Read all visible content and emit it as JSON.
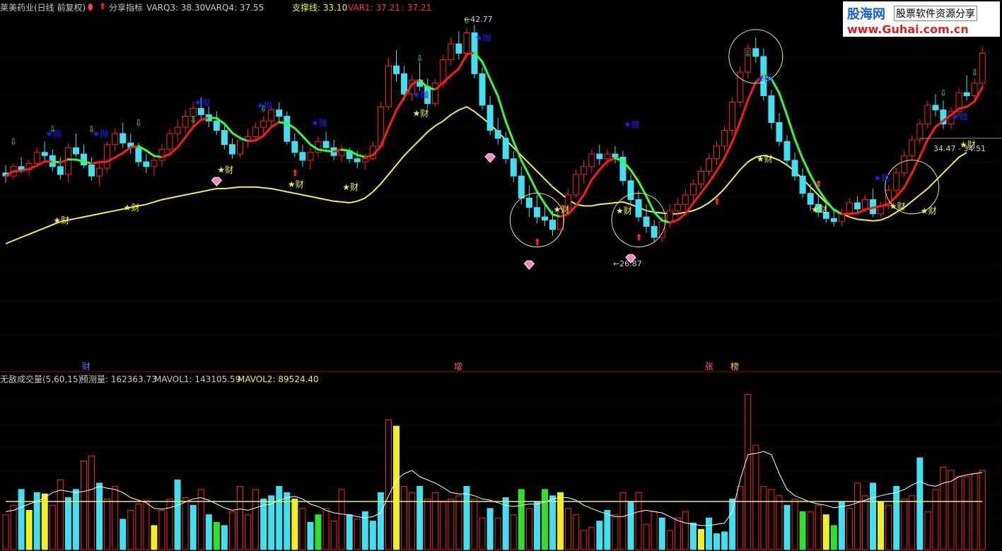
{
  "header": {
    "stock": "莱美药业(日线 前复权)",
    "indicator": "分享指标",
    "varq3": "VARQ3: 38.30",
    "varq4": "VARQ4: 37.55",
    "support": "支撑线: 33.10",
    "var1": "VAR1: 37.21",
    "var1b": ": 37.21"
  },
  "logo": {
    "brand": "股海网",
    "slogan": "股票软件资源分享",
    "url": "www.Guhai.com.cn"
  },
  "volume_header": {
    "title": "无敌成交量(5,60,15)",
    "forecast": "预测量: 162363.73",
    "mavol1": "MAVOL1: 143105.59",
    "mavol2": "MAVOL2: 89524.40"
  },
  "annotations": {
    "high_label": "42.77",
    "low_label": "26.87",
    "range_label": "34.47 - 34.51",
    "buy_text": "财",
    "sell_text": "抛",
    "bottom_labels": [
      "财",
      "增",
      "张",
      "榜"
    ]
  },
  "colors": {
    "up": "#ff2020",
    "down": "#40e0f0",
    "ma_red": "#ff1a1a",
    "ma_green": "#30ff30",
    "support": "#f0f040",
    "buy_star": "#f0f040",
    "sell_star": "#2020ff",
    "vol_yellow": "#f0f020",
    "vol_green": "#30e030"
  },
  "chart_data": {
    "type": "candlestick",
    "ylim": [
      24,
      46
    ],
    "candles": [
      [
        36.0,
        36.5,
        35.4,
        35.8
      ],
      [
        35.8,
        36.6,
        35.6,
        36.4
      ],
      [
        36.4,
        37.0,
        36.0,
        36.2
      ],
      [
        36.2,
        36.8,
        35.8,
        36.6
      ],
      [
        36.6,
        37.6,
        36.4,
        37.3
      ],
      [
        37.3,
        38.0,
        36.8,
        37.1
      ],
      [
        37.1,
        37.5,
        36.1,
        36.4
      ],
      [
        36.4,
        37.0,
        35.6,
        35.9
      ],
      [
        35.9,
        37.9,
        35.4,
        37.6
      ],
      [
        37.6,
        38.5,
        37.0,
        37.2
      ],
      [
        37.2,
        37.8,
        36.3,
        36.5
      ],
      [
        36.5,
        37.0,
        35.5,
        35.8
      ],
      [
        35.8,
        36.6,
        35.2,
        36.3
      ],
      [
        36.3,
        38.0,
        36.0,
        37.8
      ],
      [
        37.8,
        38.8,
        37.4,
        38.5
      ],
      [
        38.5,
        39.2,
        37.6,
        37.9
      ],
      [
        37.9,
        38.5,
        37.2,
        37.6
      ],
      [
        37.6,
        37.9,
        36.4,
        36.7
      ],
      [
        36.7,
        37.2,
        36.0,
        36.4
      ],
      [
        36.4,
        37.0,
        35.8,
        36.8
      ],
      [
        36.8,
        37.8,
        36.4,
        37.5
      ],
      [
        37.5,
        38.8,
        37.2,
        38.5
      ],
      [
        38.5,
        39.4,
        38.0,
        38.9
      ],
      [
        38.9,
        40.0,
        38.5,
        39.6
      ],
      [
        39.6,
        40.5,
        39.0,
        40.1
      ],
      [
        40.1,
        40.8,
        39.4,
        39.7
      ],
      [
        39.7,
        40.2,
        38.9,
        39.3
      ],
      [
        39.3,
        39.9,
        38.4,
        38.7
      ],
      [
        38.7,
        39.0,
        37.5,
        37.8
      ],
      [
        37.8,
        38.2,
        36.9,
        37.2
      ],
      [
        37.2,
        38.4,
        37.0,
        38.1
      ],
      [
        38.1,
        38.8,
        37.6,
        38.3
      ],
      [
        38.3,
        39.2,
        38.0,
        38.9
      ],
      [
        38.9,
        39.6,
        38.4,
        39.3
      ],
      [
        39.3,
        40.3,
        39.0,
        40.0
      ],
      [
        40.0,
        40.5,
        39.2,
        39.6
      ],
      [
        39.6,
        39.9,
        37.8,
        38.0
      ],
      [
        38.0,
        38.5,
        37.0,
        37.3
      ],
      [
        37.3,
        37.8,
        36.4,
        36.8
      ],
      [
        36.8,
        37.6,
        36.2,
        37.3
      ],
      [
        37.3,
        38.3,
        37.0,
        38.0
      ],
      [
        38.0,
        38.6,
        37.4,
        37.6
      ],
      [
        37.6,
        38.1,
        36.8,
        37.1
      ],
      [
        37.1,
        37.8,
        36.7,
        37.4
      ],
      [
        37.4,
        37.6,
        36.6,
        36.9
      ],
      [
        36.9,
        37.4,
        36.3,
        36.7
      ],
      [
        36.7,
        37.2,
        36.2,
        36.9
      ],
      [
        36.9,
        38.0,
        36.8,
        37.7
      ],
      [
        37.7,
        40.5,
        37.6,
        40.2
      ],
      [
        40.2,
        43.3,
        40.0,
        42.8
      ],
      [
        42.8,
        43.8,
        41.8,
        42.3
      ],
      [
        42.3,
        42.8,
        40.6,
        41.0
      ],
      [
        41.0,
        42.2,
        40.6,
        41.9
      ],
      [
        41.9,
        43.0,
        41.2,
        41.5
      ],
      [
        41.5,
        42.0,
        40.1,
        40.4
      ],
      [
        40.4,
        42.0,
        40.2,
        41.7
      ],
      [
        41.7,
        43.5,
        41.4,
        43.2
      ],
      [
        43.2,
        44.6,
        42.8,
        44.2
      ],
      [
        44.2,
        45.0,
        43.2,
        43.6
      ],
      [
        43.6,
        45.2,
        43.2,
        44.9
      ],
      [
        44.9,
        45.4,
        42.0,
        42.3
      ],
      [
        42.3,
        42.7,
        40.0,
        40.3
      ],
      [
        40.3,
        40.9,
        38.4,
        38.7
      ],
      [
        38.7,
        39.5,
        37.8,
        38.2
      ],
      [
        38.2,
        38.6,
        36.6,
        36.9
      ],
      [
        36.9,
        37.4,
        35.4,
        35.8
      ],
      [
        35.8,
        36.4,
        34.0,
        34.4
      ],
      [
        34.4,
        35.2,
        33.2,
        33.8
      ],
      [
        33.8,
        34.6,
        32.8,
        33.2
      ],
      [
        33.2,
        34.0,
        32.6,
        33.0
      ],
      [
        33.0,
        33.6,
        32.0,
        32.4
      ],
      [
        32.4,
        34.0,
        32.2,
        33.7
      ],
      [
        33.7,
        35.0,
        33.4,
        34.6
      ],
      [
        34.6,
        36.2,
        34.4,
        35.9
      ],
      [
        35.9,
        36.8,
        35.3,
        36.4
      ],
      [
        36.4,
        37.5,
        36.0,
        37.2
      ],
      [
        37.2,
        37.8,
        36.5,
        36.9
      ],
      [
        36.9,
        37.5,
        36.4,
        37.2
      ],
      [
        37.2,
        37.7,
        36.6,
        37.0
      ],
      [
        37.0,
        37.4,
        35.2,
        35.5
      ],
      [
        35.5,
        35.9,
        34.0,
        34.3
      ],
      [
        34.3,
        34.9,
        32.9,
        33.2
      ],
      [
        33.2,
        34.0,
        32.2,
        32.6
      ],
      [
        32.6,
        33.0,
        31.6,
        31.9
      ],
      [
        31.9,
        33.2,
        31.6,
        32.9
      ],
      [
        32.9,
        34.0,
        32.5,
        33.6
      ],
      [
        33.6,
        34.4,
        33.2,
        34.0
      ],
      [
        34.0,
        35.0,
        33.6,
        34.6
      ],
      [
        34.6,
        35.6,
        34.2,
        35.3
      ],
      [
        35.3,
        36.4,
        35.0,
        36.1
      ],
      [
        36.1,
        37.2,
        35.8,
        36.9
      ],
      [
        36.9,
        38.0,
        36.5,
        37.7
      ],
      [
        37.7,
        39.0,
        37.4,
        38.7
      ],
      [
        38.7,
        40.8,
        38.4,
        40.5
      ],
      [
        40.5,
        42.8,
        40.2,
        42.4
      ],
      [
        42.4,
        44.2,
        42.0,
        43.9
      ],
      [
        43.9,
        44.6,
        43.0,
        43.4
      ],
      [
        43.4,
        43.9,
        40.6,
        40.9
      ],
      [
        40.9,
        41.3,
        38.8,
        39.2
      ],
      [
        39.2,
        39.8,
        37.7,
        38.0
      ],
      [
        38.0,
        38.4,
        36.5,
        36.8
      ],
      [
        36.8,
        37.3,
        35.5,
        35.8
      ],
      [
        35.8,
        36.3,
        34.4,
        34.7
      ],
      [
        34.7,
        35.3,
        33.6,
        34.0
      ],
      [
        34.0,
        34.6,
        33.2,
        33.5
      ],
      [
        33.5,
        34.1,
        32.8,
        33.1
      ],
      [
        33.1,
        33.7,
        32.6,
        32.9
      ],
      [
        32.9,
        33.7,
        32.6,
        33.4
      ],
      [
        33.4,
        34.4,
        33.1,
        34.1
      ],
      [
        34.1,
        34.5,
        33.4,
        33.7
      ],
      [
        33.7,
        34.6,
        33.5,
        34.3
      ],
      [
        34.3,
        35.0,
        33.2,
        33.4
      ],
      [
        33.4,
        34.2,
        33.2,
        33.9
      ],
      [
        33.9,
        35.2,
        33.7,
        34.9
      ],
      [
        34.9,
        36.3,
        34.6,
        36.0
      ],
      [
        36.0,
        37.4,
        35.7,
        37.1
      ],
      [
        37.1,
        38.4,
        36.8,
        38.1
      ],
      [
        38.1,
        39.4,
        37.8,
        39.1
      ],
      [
        39.1,
        40.6,
        38.8,
        40.3
      ],
      [
        40.3,
        41.0,
        39.6,
        40.0
      ],
      [
        40.0,
        40.6,
        38.8,
        39.1
      ],
      [
        39.1,
        40.2,
        38.8,
        39.9
      ],
      [
        39.9,
        41.4,
        39.6,
        41.1
      ],
      [
        41.1,
        42.2,
        40.6,
        40.9
      ],
      [
        40.9,
        42.0,
        40.6,
        41.7
      ],
      [
        41.7,
        44.0,
        41.5,
        43.6
      ]
    ],
    "support": [
      31.5,
      31.7,
      31.9,
      32.1,
      32.3,
      32.5,
      32.7,
      32.9,
      33.0,
      33.1,
      33.2,
      33.3,
      33.4,
      33.5,
      33.6,
      33.7,
      33.8,
      33.9,
      34.0,
      34.15,
      34.3,
      34.4,
      34.5,
      34.6,
      34.7,
      34.8,
      34.9,
      35.0,
      35.0,
      35.05,
      35.1,
      35.1,
      35.1,
      35.05,
      35.0,
      34.9,
      34.8,
      34.7,
      34.6,
      34.5,
      34.4,
      34.3,
      34.2,
      34.15,
      34.1,
      34.2,
      34.4,
      34.8,
      35.3,
      35.9,
      36.5,
      37.1,
      37.6,
      38.1,
      38.6,
      39.0,
      39.3,
      39.7,
      40.0,
      40.2,
      39.9,
      39.5,
      39.1,
      38.6,
      38.1,
      37.6,
      37.1,
      36.6,
      36.1,
      35.6,
      35.1,
      34.7,
      34.3,
      34.0,
      33.9,
      33.9,
      34.0,
      34.05,
      34.1,
      34.15,
      34.0,
      33.8,
      33.6,
      33.5,
      33.45,
      33.4,
      33.4,
      33.5,
      33.6,
      33.8,
      34.1,
      34.5,
      35.0,
      35.6,
      36.2,
      36.7,
      37.0,
      37.1,
      37.0,
      36.8,
      36.5,
      36.1,
      35.6,
      35.1,
      34.6,
      34.1,
      33.7,
      33.4,
      33.2,
      33.05,
      33.0,
      32.95,
      33.0,
      33.2,
      33.5,
      33.8,
      34.2,
      34.6,
      35.0,
      35.5,
      36.0,
      36.5,
      37.0,
      37.3
    ],
    "buy_signals": [
      [
        7,
        32.8
      ],
      [
        16,
        33.6
      ],
      [
        28,
        36.0
      ],
      [
        37,
        35.1
      ],
      [
        44,
        34.9
      ],
      [
        53,
        39.6
      ],
      [
        71,
        33.5
      ],
      [
        79,
        33.4
      ],
      [
        97,
        36.7
      ],
      [
        104,
        33.5
      ],
      [
        114,
        33.7
      ],
      [
        118,
        33.4
      ],
      [
        123,
        37.6
      ]
    ],
    "sell_signals": [
      [
        6,
        38.3
      ],
      [
        12,
        38.3
      ],
      [
        25,
        40.3
      ],
      [
        33,
        40.1
      ],
      [
        40,
        39.0
      ],
      [
        53,
        40.8
      ],
      [
        61,
        44.4
      ],
      [
        80,
        38.9
      ],
      [
        97,
        41.8
      ],
      [
        112,
        35.5
      ],
      [
        122,
        39.4
      ]
    ],
    "up_arrows": [
      [
        37,
        35.8
      ],
      [
        68,
        31.4
      ],
      [
        81,
        31.7
      ],
      [
        91,
        34.0
      ],
      [
        104,
        35.1
      ]
    ],
    "down_arrows": [
      [
        1,
        37.8
      ],
      [
        6,
        38.6
      ],
      [
        11,
        38.6
      ],
      [
        17,
        39.0
      ],
      [
        24,
        39.2
      ],
      [
        33,
        39.9
      ],
      [
        53,
        43.1
      ],
      [
        59,
        45.5
      ],
      [
        95,
        43.4
      ],
      [
        120,
        40.9
      ],
      [
        124,
        42.2
      ]
    ],
    "diamonds": [
      [
        27,
        35.4
      ],
      [
        62,
        36.9
      ],
      [
        67,
        30.1
      ],
      [
        80,
        30.5
      ]
    ],
    "circles": [
      [
        68,
        33.0
      ],
      [
        81,
        33.0
      ],
      [
        96,
        43.4
      ],
      [
        116,
        35.1
      ]
    ],
    "volume_ylim": [
      0,
      260000
    ],
    "volume": [
      55000,
      70000,
      95000,
      62000,
      90000,
      88000,
      70000,
      110000,
      82000,
      95000,
      140000,
      148000,
      105000,
      80000,
      100000,
      48000,
      62000,
      72000,
      78000,
      38000,
      62000,
      80000,
      110000,
      82000,
      70000,
      95000,
      55000,
      43000,
      38000,
      60000,
      100000,
      55000,
      95000,
      80000,
      85000,
      100000,
      90000,
      80000,
      65000,
      43000,
      55000,
      65000,
      45000,
      95000,
      55000,
      48000,
      60000,
      45000,
      90000,
      205000,
      195000,
      100000,
      90000,
      100000,
      80000,
      90000,
      75000,
      80000,
      85000,
      100000,
      80000,
      50000,
      65000,
      50000,
      82000,
      55000,
      95000,
      65000,
      75000,
      95000,
      85000,
      90000,
      65000,
      55000,
      30000,
      35000,
      45000,
      62000,
      55000,
      90000,
      75000,
      90000,
      40000,
      60000,
      50000,
      30000,
      50000,
      60000,
      42000,
      32000,
      50000,
      25000,
      28000,
      80000,
      100000,
      245000,
      165000,
      100000,
      95000,
      85000,
      70000,
      80000,
      60000,
      60000,
      70000,
      55000,
      38000,
      75000,
      65000,
      105000,
      85000,
      105000,
      75000,
      70000,
      100000,
      80000,
      85000,
      145000,
      60000,
      95000,
      130000,
      125000,
      115000,
      115000,
      120000,
      125000
    ],
    "volume_colors": "RRcYcYRRccRRcRRcRRRYRRcRcRcGcRRRRccccYRcGRRRcRcccRYRRcRRRRRcRRcRcRGRcGcYRRRRccRRcRRRcRRRcYccccRRRRRRcRGRRYGcRRRcYRcRRcRRR",
    "mavol1": [
      60000,
      62000,
      67000,
      72000,
      76000,
      82000,
      90000,
      94000,
      92000,
      90000,
      92000,
      95000,
      100000,
      97000,
      95000,
      90000,
      82000,
      78000,
      74000,
      65000,
      64000,
      66000,
      70000,
      75000,
      80000,
      82000,
      78000,
      72000,
      66000,
      62000,
      64000,
      62000,
      66000,
      70000,
      72000,
      78000,
      82000,
      84000,
      80000,
      72000,
      68000,
      62000,
      58000,
      56000,
      55000,
      52000,
      50000,
      52000,
      58000,
      85000,
      110000,
      120000,
      125000,
      115000,
      110000,
      105000,
      98000,
      90000,
      88000,
      88000,
      85000,
      80000,
      78000,
      74000,
      70000,
      68000,
      70000,
      72000,
      72000,
      75000,
      80000,
      82000,
      82000,
      78000,
      70000,
      65000,
      60000,
      56000,
      52000,
      52000,
      56000,
      60000,
      62000,
      60000,
      58000,
      52000,
      46000,
      42000,
      40000,
      38000,
      38000,
      40000,
      42000,
      60000,
      110000,
      150000,
      152000,
      155000,
      150000,
      120000,
      95000,
      85000,
      80000,
      75000,
      72000,
      70000,
      66000,
      68000,
      70000,
      74000,
      78000,
      82000,
      85000,
      88000,
      90000,
      95000,
      102000,
      108000,
      102000,
      100000,
      105000,
      108000,
      115000,
      118000,
      120000,
      122000
    ],
    "mavol2": 76000
  }
}
